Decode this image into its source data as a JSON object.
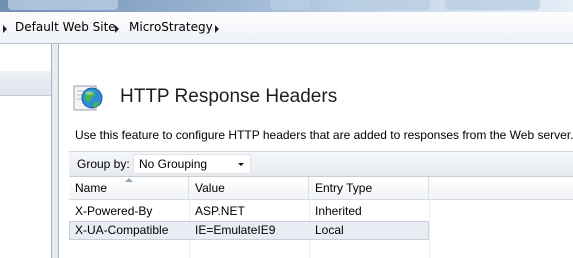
{
  "breadcrumb": {
    "items": [
      {
        "label": "Default Web Site"
      },
      {
        "label": "MicroStrategy"
      }
    ]
  },
  "feature": {
    "title": "HTTP Response Headers",
    "icon": "globe-icon",
    "description": "Use this feature to configure HTTP headers that are added to responses from the Web server."
  },
  "group_by": {
    "label": "Group by:",
    "value": "No Grouping"
  },
  "table": {
    "columns": [
      "Name",
      "Value",
      "Entry Type"
    ],
    "rows": [
      {
        "name": "X-Powered-By",
        "value": "ASP.NET",
        "entry_type": "Inherited"
      },
      {
        "name": "X-UA-Compatible",
        "value": "IE=EmulateIE9",
        "entry_type": "Local"
      }
    ]
  },
  "colors": {
    "selected_row": "#e9edf3",
    "header_bg": "#eef2f7"
  }
}
